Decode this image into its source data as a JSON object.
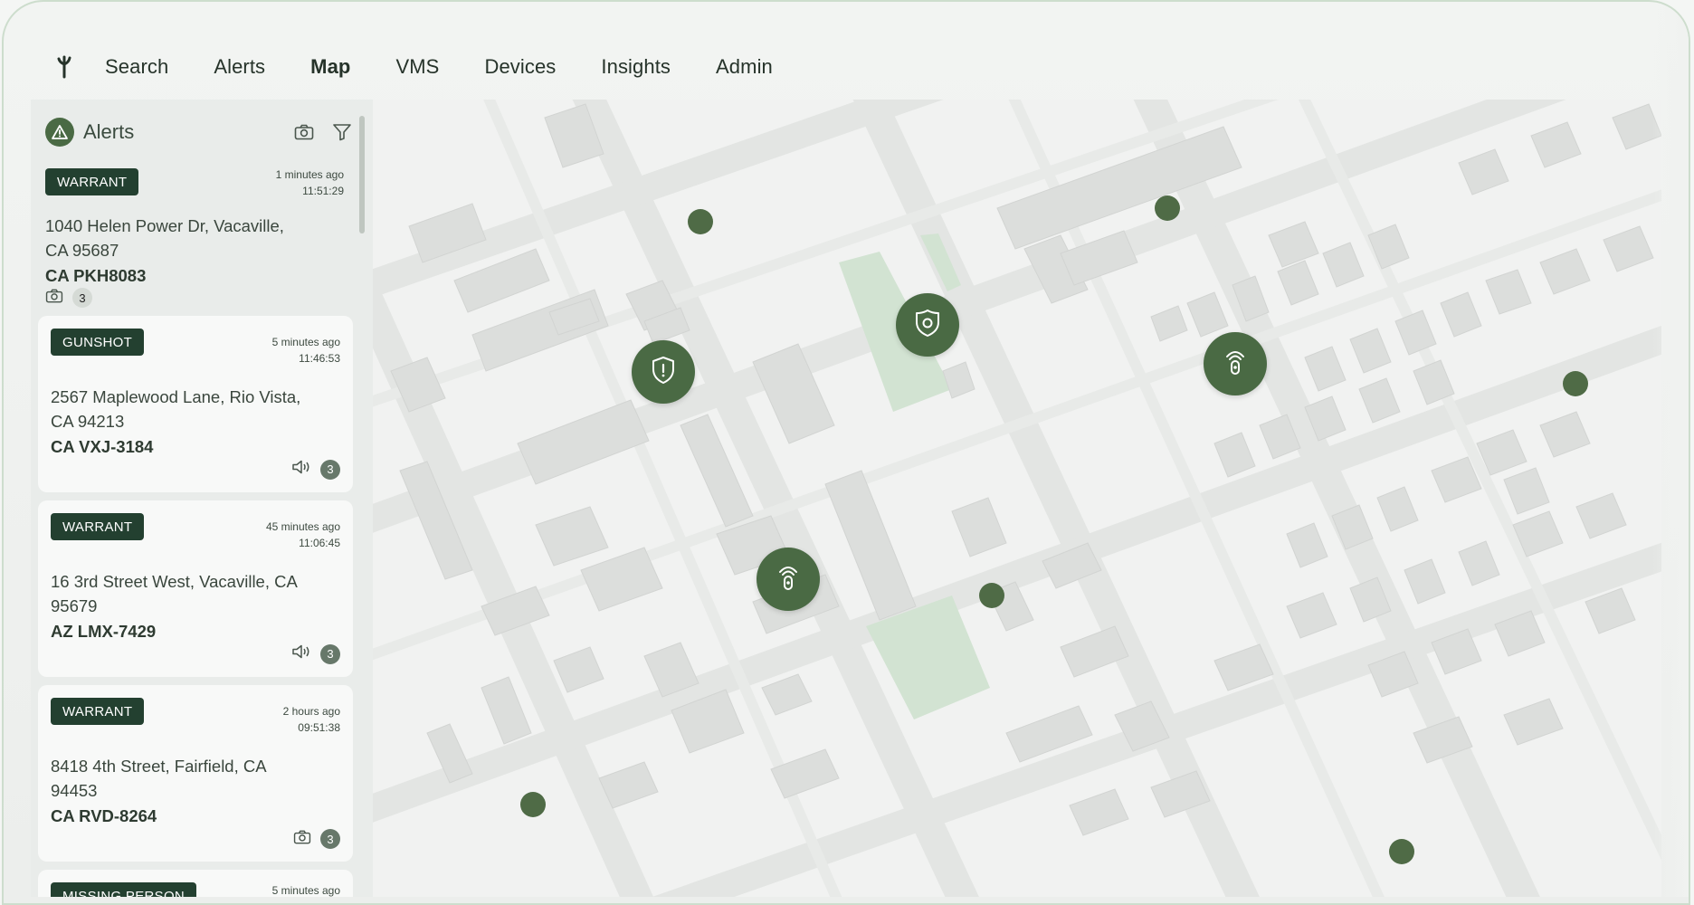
{
  "nav": {
    "items": [
      {
        "label": "Search",
        "active": false
      },
      {
        "label": "Alerts",
        "active": false
      },
      {
        "label": "Map",
        "active": true
      },
      {
        "label": "VMS",
        "active": false
      },
      {
        "label": "Devices",
        "active": false
      },
      {
        "label": "Insights",
        "active": false
      },
      {
        "label": "Admin",
        "active": false
      }
    ]
  },
  "sidebar": {
    "title": "Alerts",
    "alerts": [
      {
        "badge": "WARRANT",
        "ago": "1 minutes ago",
        "time": "11:51:29",
        "address": "1040 Helen Power Dr, Vacaville, CA 95687",
        "plate": "CA PKH8083",
        "media_icon": "camera-icon",
        "count": "3"
      },
      {
        "badge": "GUNSHOT",
        "ago": "5 minutes ago",
        "time": "11:46:53",
        "address": "2567 Maplewood Lane, Rio Vista, CA 94213",
        "plate": "CA VXJ-3184",
        "media_icon": "speaker-icon",
        "count": "3"
      },
      {
        "badge": "WARRANT",
        "ago": "45 minutes ago",
        "time": "11:06:45",
        "address": "16 3rd Street West, Vacaville, CA 95679",
        "plate": "AZ LMX-7429",
        "media_icon": "speaker-icon",
        "count": "3"
      },
      {
        "badge": "WARRANT",
        "ago": "2 hours ago",
        "time": "09:51:38",
        "address": "8418 4th Street, Fairfield, CA 94453",
        "plate": "CA RVD-8264",
        "media_icon": "camera-icon",
        "count": "3"
      },
      {
        "badge": "MISSING PERSON",
        "ago": "5 minutes ago"
      }
    ]
  },
  "map": {
    "markers": [
      {
        "kind": "shield-alert",
        "icon": "shield-alert-icon"
      },
      {
        "kind": "police-badge",
        "icon": "police-badge-icon"
      },
      {
        "kind": "sensor",
        "icon": "sensor-icon"
      },
      {
        "kind": "sensor",
        "icon": "sensor-icon"
      }
    ]
  },
  "colors": {
    "accent": "#4a6a44",
    "badge": "#234030",
    "park": "#d2e3d2",
    "building": "#dcdedc",
    "road": "#e6e8e6"
  }
}
